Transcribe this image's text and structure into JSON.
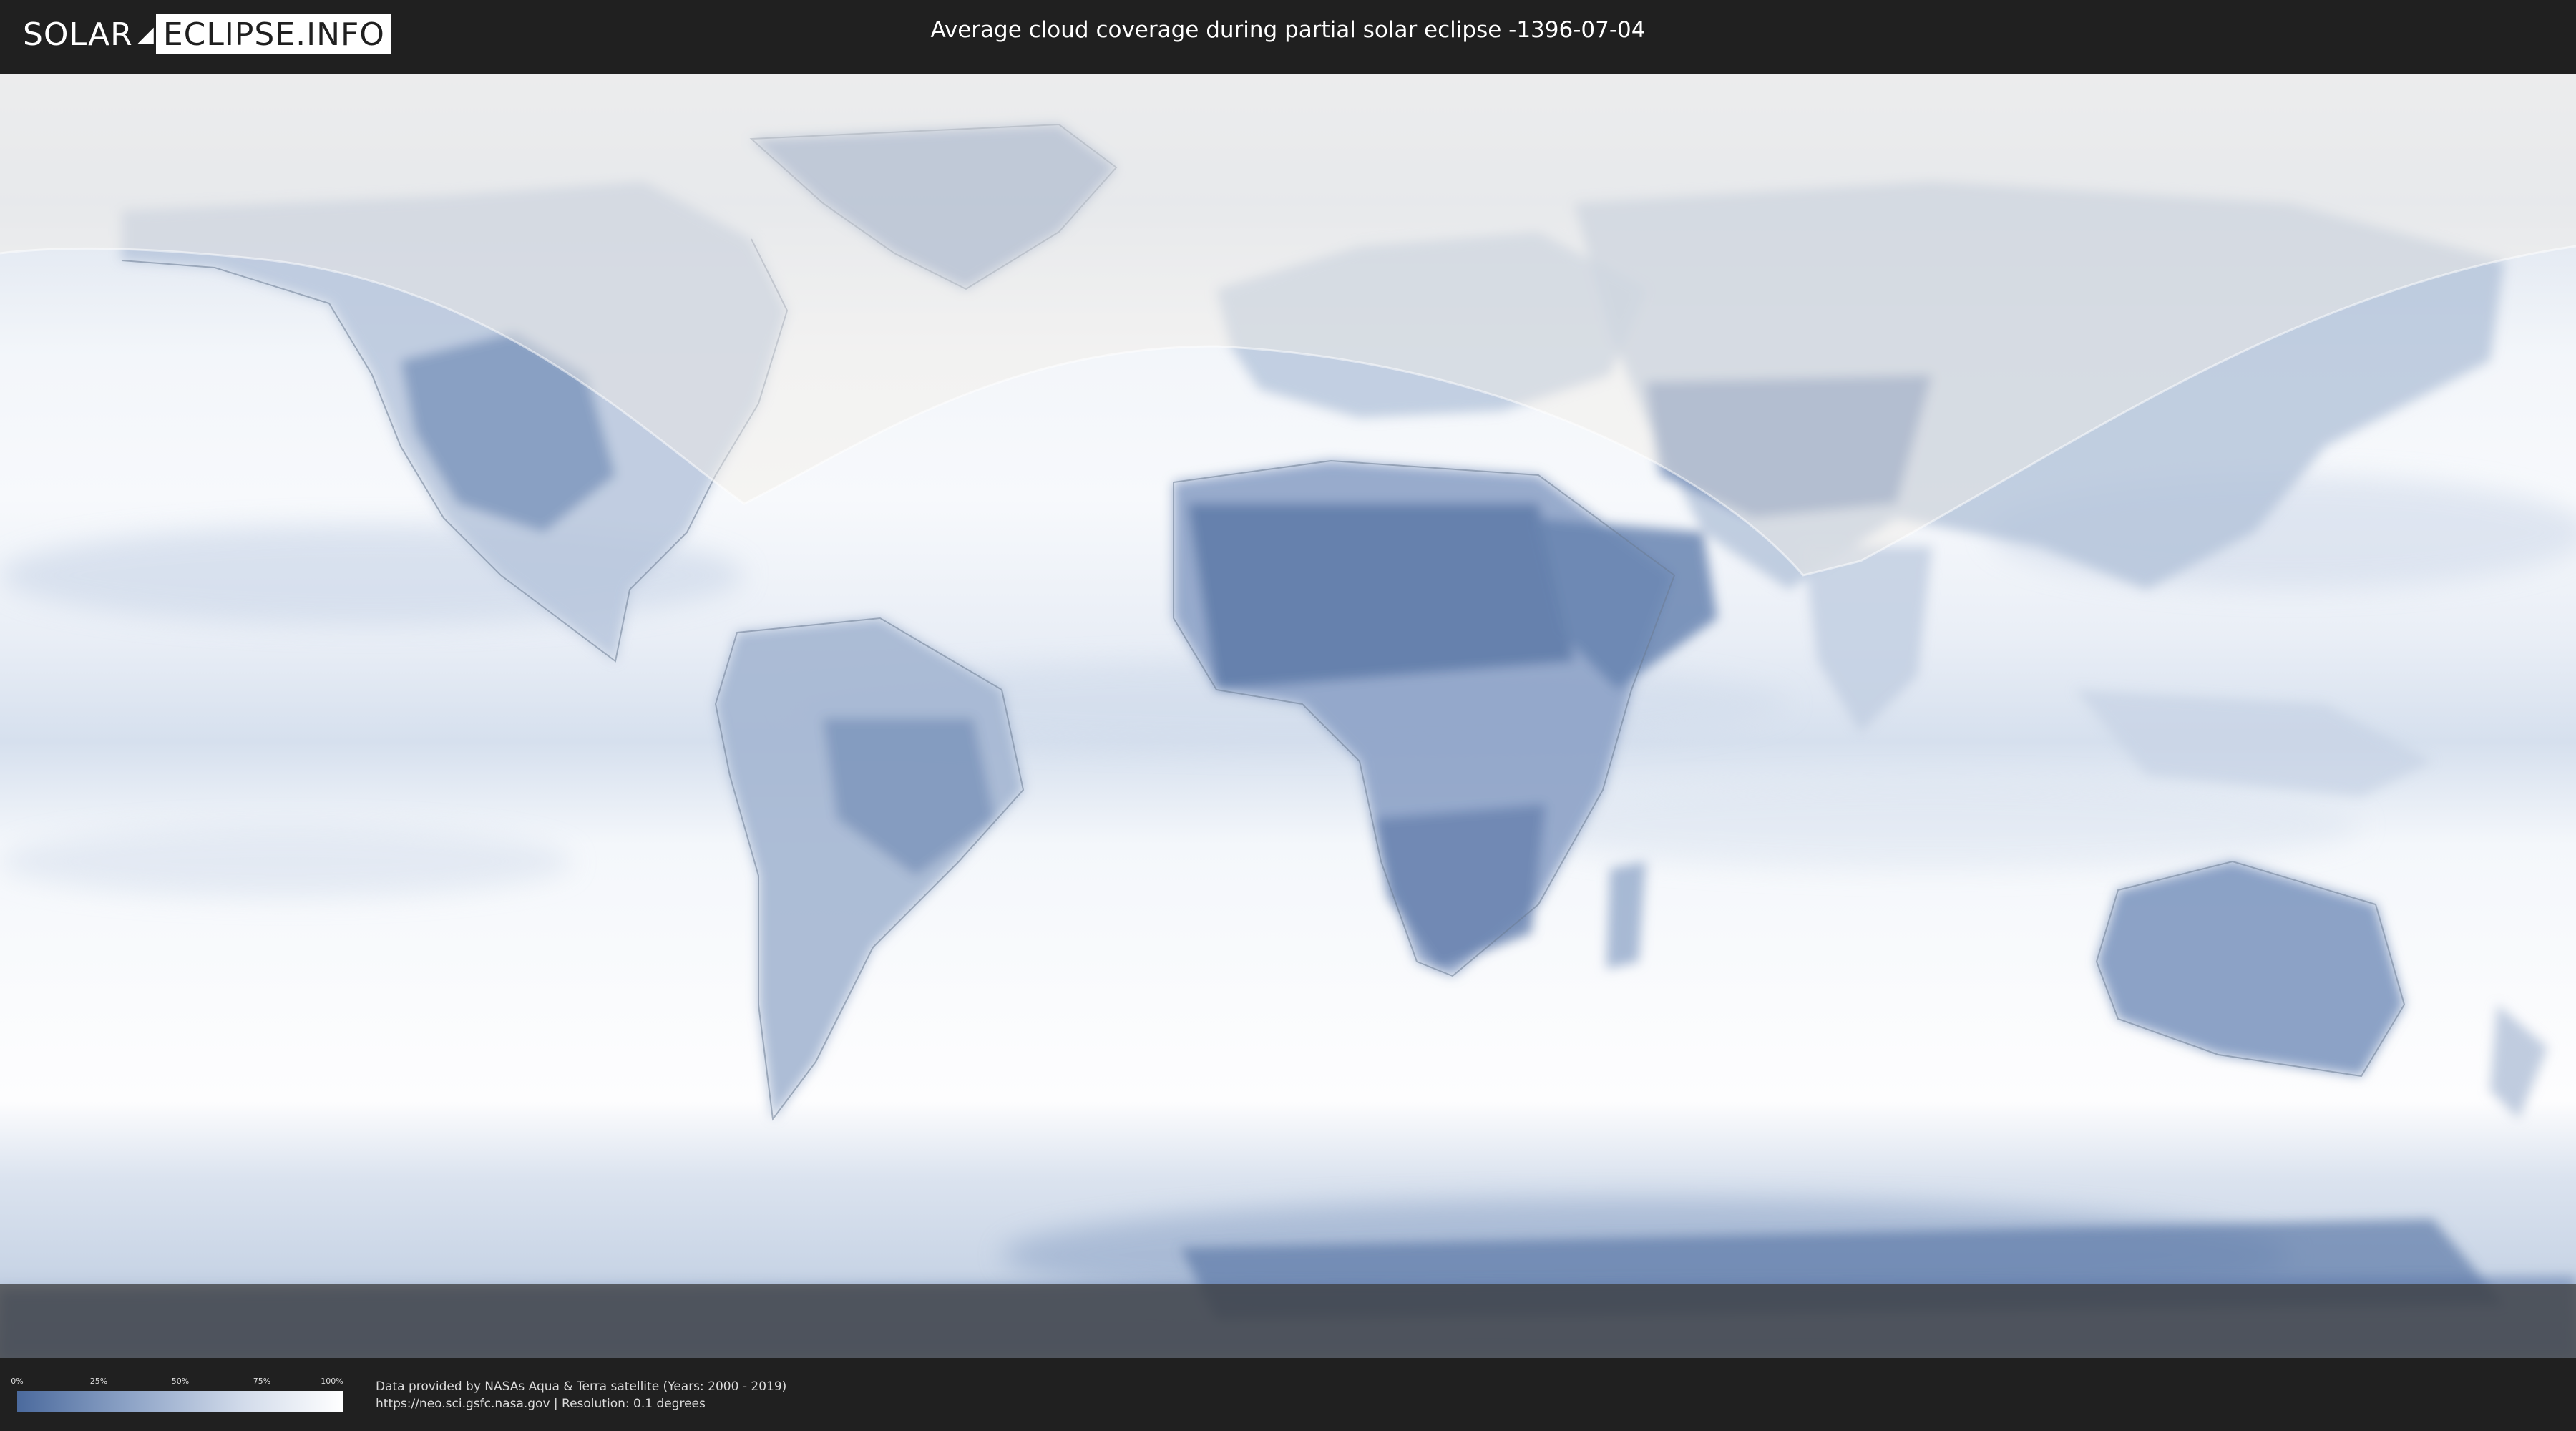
{
  "header": {
    "logo_left": "SOLAR",
    "logo_right": "ECLIPSE.INFO",
    "title": "Average cloud coverage during partial solar eclipse -1396-07-04"
  },
  "map": {
    "description_colors": {
      "clear": "#4b6a9d",
      "cloudy": "#ffffff",
      "eclipse_overlay": "#f2ede6"
    }
  },
  "legend": {
    "ticks": [
      "0%",
      "25%",
      "50%",
      "75%",
      "100%"
    ],
    "gradient_start": "#4b6a9d",
    "gradient_end": "#ffffff"
  },
  "footer": {
    "credit_line1": "Data provided by NASAs Aqua & Terra satellite (Years: 2000 - 2019)",
    "credit_line2": "https://neo.sci.gsfc.nasa.gov | Resolution: 0.1 degrees"
  }
}
